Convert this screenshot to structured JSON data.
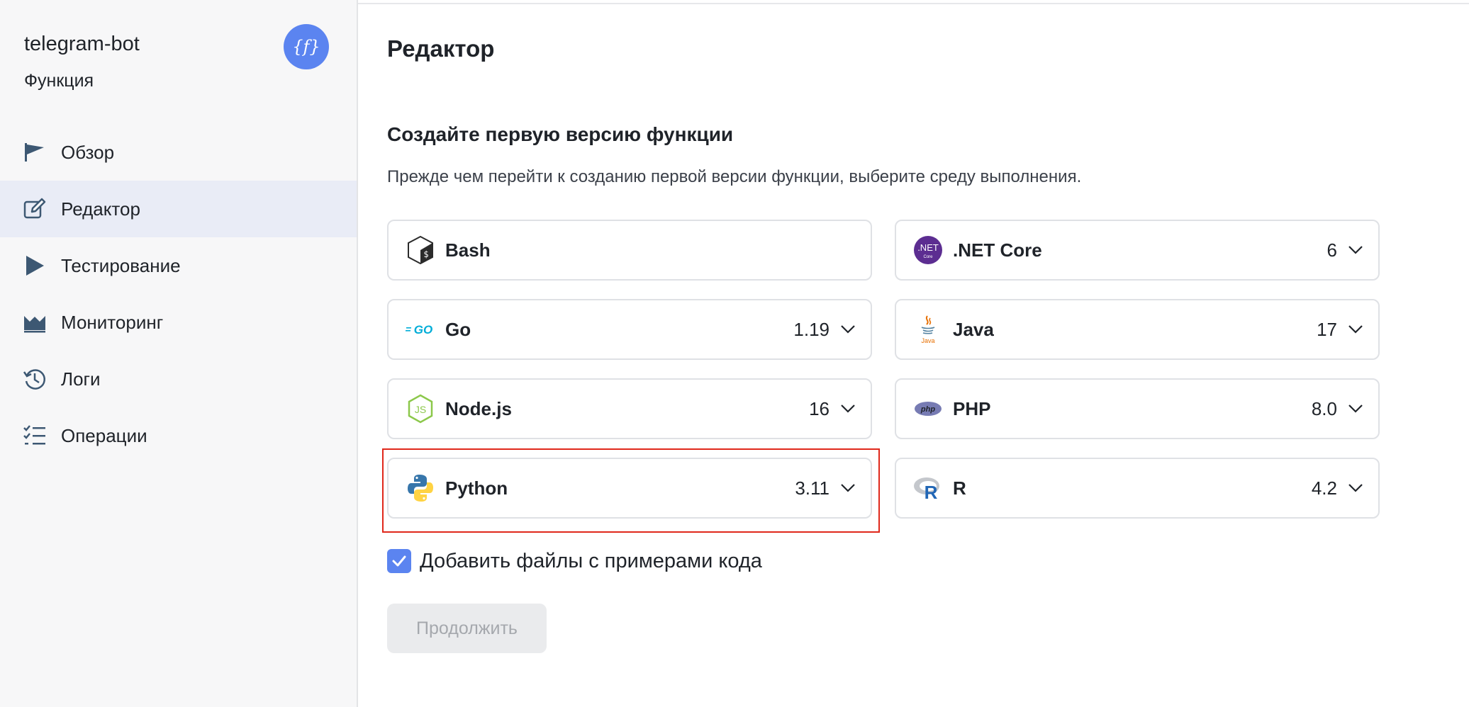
{
  "service": {
    "name": "telegram-bot",
    "type": "Функция",
    "avatar_icon": "function-braces-icon",
    "avatar_color": "#5b84f0"
  },
  "nav": {
    "items": [
      {
        "label": "Обзор",
        "icon": "flag-icon",
        "active": false
      },
      {
        "label": "Редактор",
        "icon": "edit-icon",
        "active": true
      },
      {
        "label": "Тестирование",
        "icon": "play-icon",
        "active": false
      },
      {
        "label": "Мониторинг",
        "icon": "chart-area-icon",
        "active": false
      },
      {
        "label": "Логи",
        "icon": "history-icon",
        "active": false
      },
      {
        "label": "Операции",
        "icon": "checklist-icon",
        "active": false
      }
    ]
  },
  "main": {
    "title": "Редактор",
    "section_title": "Создайте первую версию функции",
    "section_description": "Прежде чем перейти к созданию первой версии функции, выберите среду выполнения.",
    "runtimes": [
      {
        "name": "Bash",
        "version": "",
        "icon": "bash-icon"
      },
      {
        "name": ".NET Core",
        "version": "6",
        "icon": "dotnet-icon"
      },
      {
        "name": "Go",
        "version": "1.19",
        "icon": "go-icon"
      },
      {
        "name": "Java",
        "version": "17",
        "icon": "java-icon"
      },
      {
        "name": "Node.js",
        "version": "16",
        "icon": "nodejs-icon"
      },
      {
        "name": "PHP",
        "version": "8.0",
        "icon": "php-icon"
      },
      {
        "name": "Python",
        "version": "3.11",
        "icon": "python-icon",
        "selected": true
      },
      {
        "name": "R",
        "version": "4.2",
        "icon": "r-icon"
      }
    ],
    "sample_files_checkbox": {
      "label": "Добавить файлы с примерами кода",
      "checked": true
    },
    "continue_label": "Продолжить"
  },
  "colors": {
    "accent": "#5b84f0",
    "highlight": "#e0281b",
    "nav_active_bg": "#e9ecf6",
    "nav_icon": "#3d5873"
  }
}
